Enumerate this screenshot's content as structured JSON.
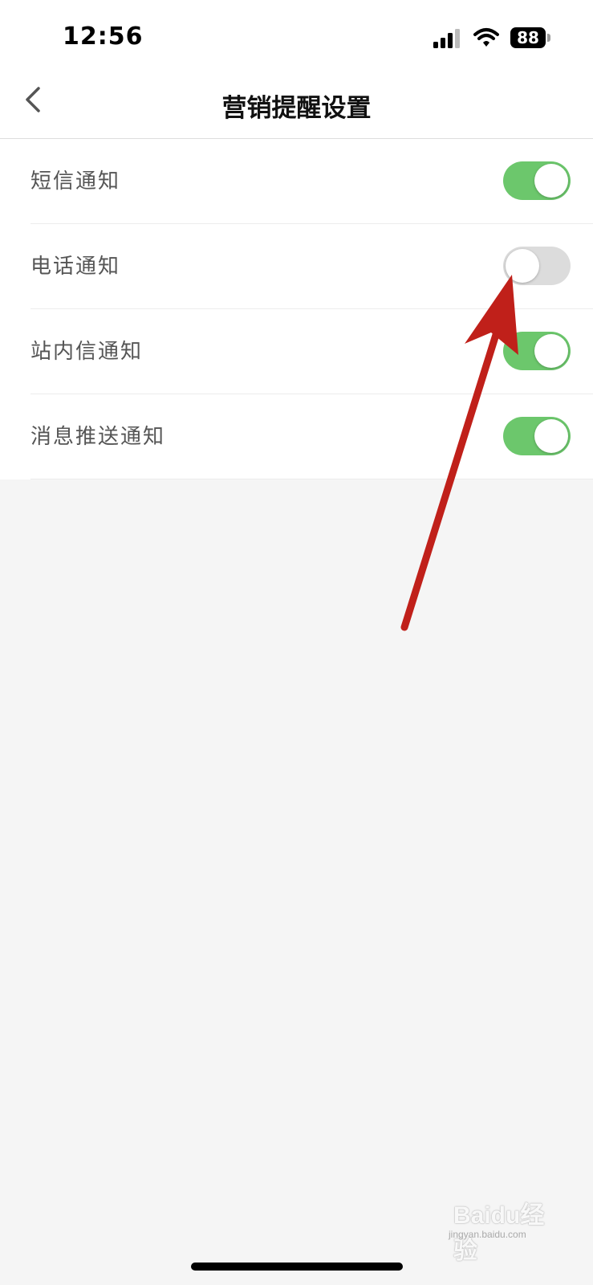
{
  "status_bar": {
    "time": "12:56",
    "battery_level": "88",
    "icons": [
      "cellular-signal-icon",
      "wifi-icon",
      "battery-icon"
    ]
  },
  "nav": {
    "title": "营销提醒设置",
    "back_icon": "chevron-left-icon"
  },
  "settings": [
    {
      "label": "短信通知",
      "enabled": true
    },
    {
      "label": "电话通知",
      "enabled": false
    },
    {
      "label": "站内信通知",
      "enabled": true
    },
    {
      "label": "消息推送通知",
      "enabled": true
    }
  ],
  "watermark": {
    "brand": "Baidu经验",
    "url": "jingyan.baidu.com"
  },
  "colors": {
    "toggle_on": "#6cc76c",
    "toggle_off": "#dcdcdc",
    "annotation_arrow": "#c0201a",
    "background": "#f5f5f5"
  }
}
